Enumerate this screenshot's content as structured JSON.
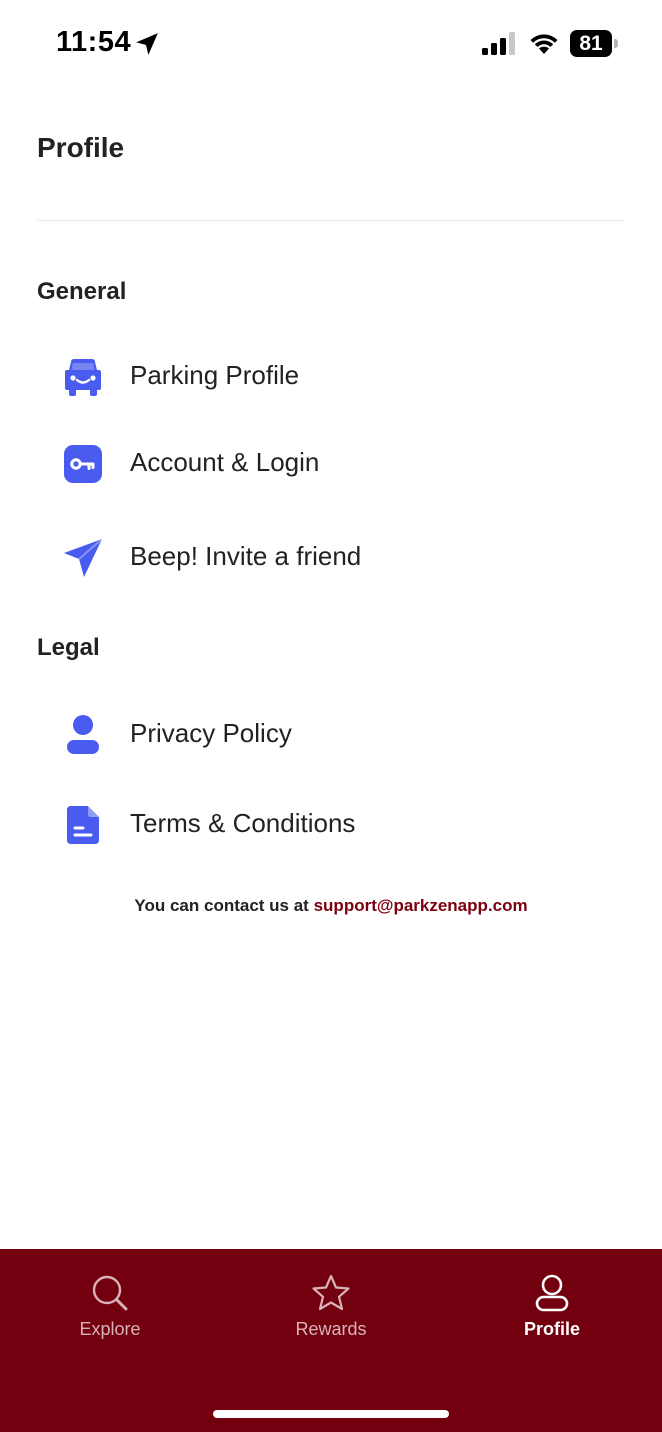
{
  "status_bar": {
    "time": "11:54",
    "battery": "81"
  },
  "header": {
    "title": "Profile"
  },
  "sections": {
    "general": {
      "heading": "General",
      "items": [
        {
          "label": "Parking Profile",
          "icon": "car-icon"
        },
        {
          "label": "Account & Login",
          "icon": "key-icon"
        },
        {
          "label": "Beep! Invite a friend",
          "icon": "paper-plane-icon"
        }
      ]
    },
    "legal": {
      "heading": "Legal",
      "items": [
        {
          "label": "Privacy Policy",
          "icon": "person-icon"
        },
        {
          "label": "Terms & Conditions",
          "icon": "document-icon"
        }
      ]
    }
  },
  "contact": {
    "prefix": "You can contact us at",
    "email": "support@parkzenapp.com"
  },
  "tab_bar": {
    "tabs": [
      {
        "label": "Explore",
        "icon": "search-icon",
        "active": false
      },
      {
        "label": "Rewards",
        "icon": "star-icon",
        "active": false
      },
      {
        "label": "Profile",
        "icon": "user-icon",
        "active": true
      }
    ]
  },
  "colors": {
    "accent": "#4a5cf0",
    "brand": "#73000e",
    "link": "#7a0010"
  }
}
